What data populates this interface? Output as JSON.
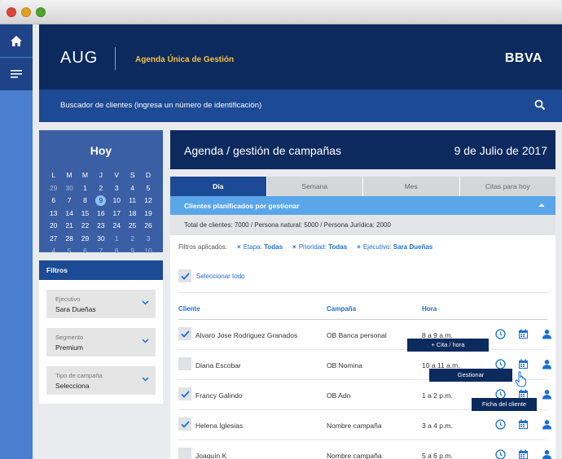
{
  "header": {
    "brand": "AUG",
    "app_title": "Agenda Única de Gestión",
    "bank_logo": "BBVA"
  },
  "search": {
    "label": "Buscador de clientes (ingresa un número de identificación)"
  },
  "today": {
    "title": "Hoy",
    "weekdays": [
      "L",
      "M",
      "M",
      "J",
      "V",
      "S",
      "D"
    ],
    "weeks": [
      [
        {
          "d": "29",
          "m": 1
        },
        {
          "d": "30",
          "m": 1
        },
        {
          "d": "1"
        },
        {
          "d": "2"
        },
        {
          "d": "3"
        },
        {
          "d": "4"
        },
        {
          "d": "5"
        }
      ],
      [
        {
          "d": "6"
        },
        {
          "d": "7"
        },
        {
          "d": "8"
        },
        {
          "d": "9",
          "sel": 1
        },
        {
          "d": "10"
        },
        {
          "d": "11"
        },
        {
          "d": "12"
        }
      ],
      [
        {
          "d": "13"
        },
        {
          "d": "14"
        },
        {
          "d": "15"
        },
        {
          "d": "16"
        },
        {
          "d": "17"
        },
        {
          "d": "18"
        },
        {
          "d": "19"
        }
      ],
      [
        {
          "d": "20"
        },
        {
          "d": "21"
        },
        {
          "d": "22"
        },
        {
          "d": "23"
        },
        {
          "d": "24"
        },
        {
          "d": "25"
        },
        {
          "d": "26"
        }
      ],
      [
        {
          "d": "27"
        },
        {
          "d": "28"
        },
        {
          "d": "29"
        },
        {
          "d": "30"
        },
        {
          "d": "1",
          "m": 1
        },
        {
          "d": "2",
          "m": 1
        },
        {
          "d": "3",
          "m": 1
        }
      ],
      [
        {
          "d": "4",
          "m": 1
        },
        {
          "d": "5",
          "m": 1
        },
        {
          "d": "6",
          "m": 1
        },
        {
          "d": "7",
          "m": 1
        },
        {
          "d": "8",
          "m": 1
        },
        {
          "d": "9",
          "m": 1
        },
        {
          "d": "10",
          "m": 1
        }
      ]
    ]
  },
  "filters": {
    "title": "Filtros",
    "ejecutivo": {
      "label": "Ejecutivo",
      "value": "Sara Dueñas"
    },
    "segmento": {
      "label": "Segmento",
      "value": "Premium"
    },
    "tipo": {
      "label": "Tipo de campaña",
      "value": "Selecciona"
    }
  },
  "main": {
    "title": "Agenda / gestión de campañas",
    "date": "9 de Julio de 2017",
    "tabs": [
      "Día",
      "Semana",
      "Mes",
      "Citas para hoy"
    ],
    "planned_label": "Clientes planificados por gestionar",
    "totals": "Total de clientes: 7000 / Persona natural: 5000 / Persona Jurídica: 2000",
    "filters_applied_label": "Filtros aplicados:",
    "chips": [
      {
        "key": "Etapa:",
        "value": "Todas"
      },
      {
        "key": "Prioridad:",
        "value": "Todas"
      },
      {
        "key": "Ejecutivo:",
        "value": "Sara Dueñas"
      }
    ],
    "select_all": "Seleccionar todo",
    "columns": [
      "Cliente",
      "Campaña",
      "Hora"
    ],
    "rows": [
      {
        "cliente": "Alvaro Jose Rodriguez Granados",
        "campana": "OB Banca personal",
        "hora": "8 a 9 a.m.",
        "checked": true
      },
      {
        "cliente": "Diana Escobar",
        "campana": "OB Nomina",
        "hora": "10 a 11 a.m.",
        "checked": false
      },
      {
        "cliente": "Francy Galindo",
        "campana": "OB Adn",
        "hora": "1 a 2 p.m.",
        "checked": true
      },
      {
        "cliente": "Helena Iglesias",
        "campana": "Nombre campaña",
        "hora": "3 a 4 p.m.",
        "checked": true
      },
      {
        "cliente": "Joaquín K",
        "campana": "Nombre campaña",
        "hora": "5 a 6 p.m.",
        "checked": false
      }
    ],
    "tooltips": {
      "cita": "+ Cita / hora",
      "gestionar": "Gestionar",
      "ficha": "Ficha del cliente"
    }
  },
  "colors": {
    "navy": "#0c2a5e",
    "blue": "#1c4a94",
    "accent": "#1c6fcf",
    "gold": "#f5c242"
  }
}
